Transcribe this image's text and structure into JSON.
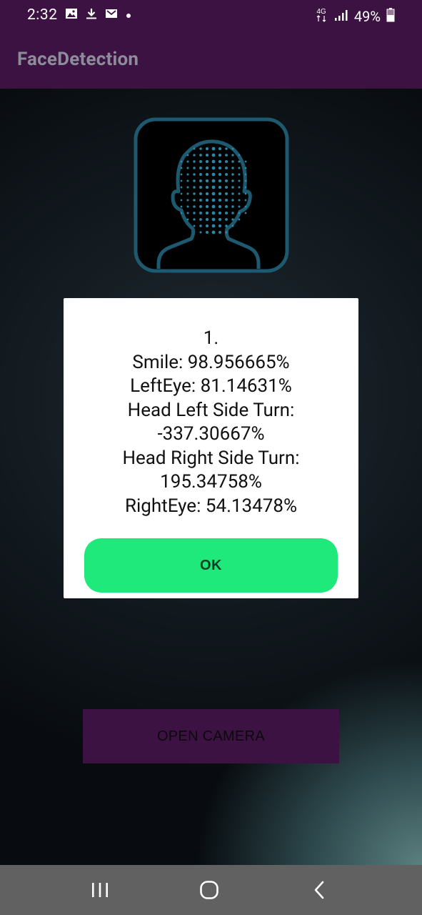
{
  "status_bar": {
    "time": "2:32",
    "notification_icons": [
      "image-icon",
      "download-icon",
      "mail-icon",
      "dot-icon"
    ],
    "network": "4G",
    "battery_text": "49%"
  },
  "app_bar": {
    "title": "FaceDetection"
  },
  "main": {
    "logo_icon": "face-scan-icon"
  },
  "dialog": {
    "lines": [
      "1.",
      "Smile: 98.956665%",
      "LeftEye: 81.14631%",
      "Head Left Side Turn:",
      "-337.30667%",
      "Head Right Side Turn:",
      "195.34758%",
      "RightEye: 54.13478%"
    ],
    "ok_label": "OK"
  },
  "camera_button_label": "OPEN CAMERA",
  "colors": {
    "primary": "#3c1242",
    "accent": "#1ee97a",
    "dialog_bg": "#ffffff",
    "nav_bar": "#616161",
    "logo_stroke": "#1d5a70"
  },
  "nav_bar": {
    "icons": [
      "recent-apps-icon",
      "home-icon",
      "back-icon"
    ]
  }
}
